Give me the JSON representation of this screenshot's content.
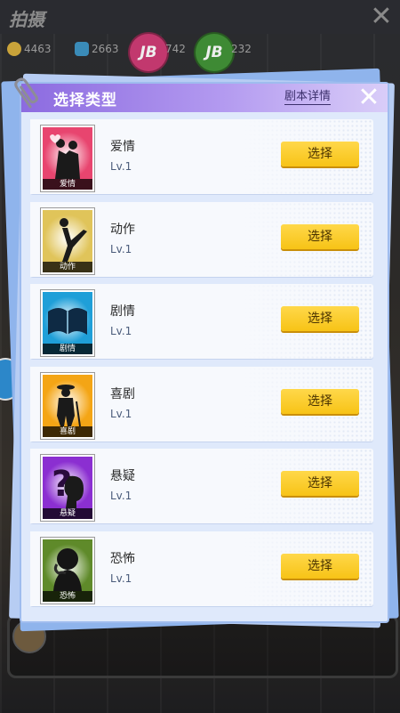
{
  "background": {
    "title": "拍摄",
    "stats": [
      {
        "icon": "coin-icon",
        "value": "4463"
      },
      {
        "icon": "people-icon",
        "value": "2663"
      },
      {
        "icon": "pink-badge-icon",
        "value": "742"
      },
      {
        "icon": "green-badge-icon",
        "value": "232"
      }
    ],
    "badge_text": "JB"
  },
  "modal": {
    "title": "选择类型",
    "details_link": "剧本详情",
    "select_label": "选择",
    "genres": [
      {
        "name": "爱情",
        "level": "Lv.1",
        "caption": "爱情",
        "icon": "romance-icon",
        "color": "#e8456f"
      },
      {
        "name": "动作",
        "level": "Lv.1",
        "caption": "动作",
        "icon": "action-icon",
        "color": "#e0c45a"
      },
      {
        "name": "剧情",
        "level": "Lv.1",
        "caption": "剧情",
        "icon": "drama-book-icon",
        "color": "#1f9fd8"
      },
      {
        "name": "喜剧",
        "level": "Lv.1",
        "caption": "喜剧",
        "icon": "comedy-icon",
        "color": "#f4a515"
      },
      {
        "name": "悬疑",
        "level": "Lv.1",
        "caption": "悬疑",
        "icon": "mystery-icon",
        "color": "#8b2fd1"
      },
      {
        "name": "恐怖",
        "level": "Lv.1",
        "caption": "恐怖",
        "icon": "horror-icon",
        "color": "#5f8a2a"
      }
    ]
  },
  "colors": {
    "header_purple": "#8c6be0",
    "panel_bg": "#dfe9fb",
    "button_yellow": "#f7c316"
  }
}
